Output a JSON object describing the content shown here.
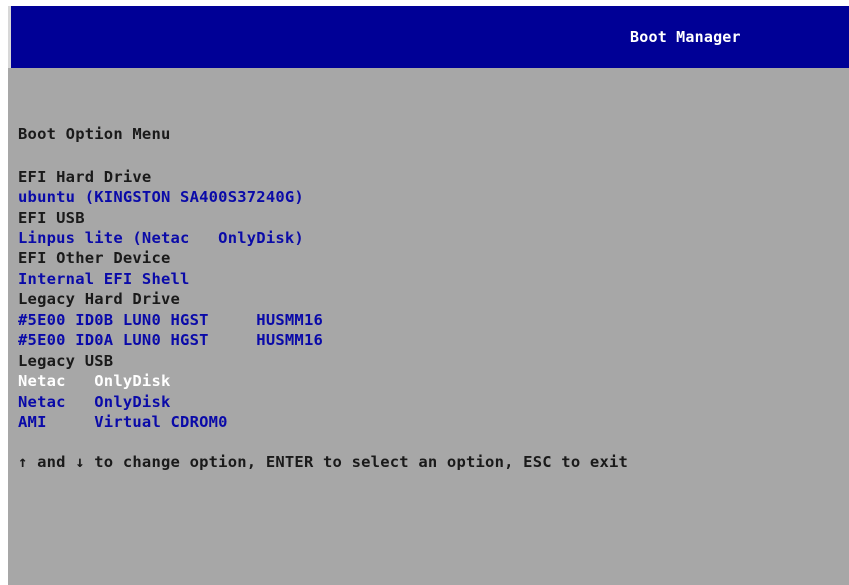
{
  "header": {
    "title": "Boot Manager"
  },
  "menu": {
    "heading": "Boot Option Menu",
    "groups": [
      {
        "label": "EFI Hard Drive",
        "options": [
          "ubuntu (KINGSTON SA400S37240G)"
        ]
      },
      {
        "label": "EFI USB",
        "options": [
          "Linpus lite (Netac   OnlyDisk)"
        ]
      },
      {
        "label": "EFI Other Device",
        "options": [
          "Internal EFI Shell"
        ]
      },
      {
        "label": "Legacy Hard Drive",
        "options": [
          "#5E00 ID0B LUN0 HGST     HUSMM16",
          "#5E00 ID0A LUN0 HGST     HUSMM16"
        ]
      },
      {
        "label": "Legacy USB",
        "options": [
          "Netac   OnlyDisk",
          "Netac   OnlyDisk",
          "AMI     Virtual CDROM0"
        ]
      }
    ],
    "selected_option": "Netac   OnlyDisk"
  },
  "footer": {
    "help": "↑ and ↓ to change option, ENTER to select an option, ESC to exit"
  },
  "colors": {
    "titlebar": "#000096",
    "background": "#a7a7a7",
    "option_text": "#0a0aa8",
    "selected_text": "#ffffff",
    "label_text": "#1a1a1a"
  }
}
